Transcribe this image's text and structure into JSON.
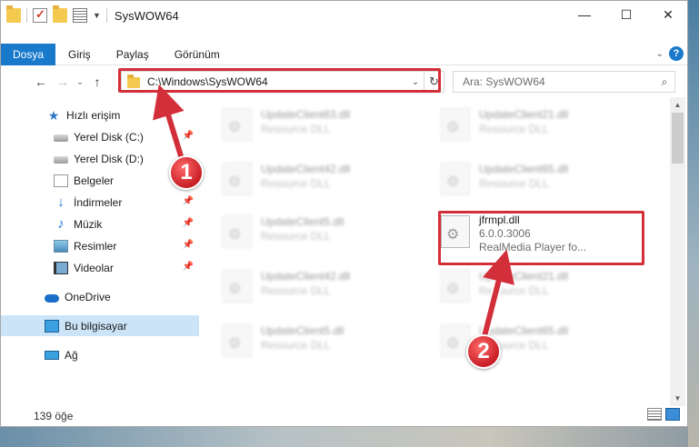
{
  "window": {
    "title": "SysWOW64",
    "controls": {
      "minimize": "—",
      "maximize": "☐",
      "close": "✕"
    }
  },
  "ribbon": {
    "tabs": [
      {
        "label": "Dosya"
      },
      {
        "label": "Giriş"
      },
      {
        "label": "Paylaş"
      },
      {
        "label": "Görünüm"
      }
    ],
    "help": "?"
  },
  "navigation": {
    "address": "C:\\Windows\\SysWOW64",
    "search_placeholder": "Ara: SysWOW64"
  },
  "sidebar": {
    "items": [
      {
        "label": "Hızlı erişim",
        "icon": "star-icon"
      },
      {
        "label": "Yerel Disk (C:)",
        "icon": "disk-icon"
      },
      {
        "label": "Yerel Disk (D:)",
        "icon": "disk-icon"
      },
      {
        "label": "Belgeler",
        "icon": "documents-icon"
      },
      {
        "label": "İndirmeler",
        "icon": "download-icon"
      },
      {
        "label": "Müzik",
        "icon": "music-icon"
      },
      {
        "label": "Resimler",
        "icon": "pictures-icon"
      },
      {
        "label": "Videolar",
        "icon": "videos-icon"
      },
      {
        "label": "OneDrive",
        "icon": "cloud-icon"
      },
      {
        "label": "Bu bilgisayar",
        "icon": "computer-icon"
      },
      {
        "label": "Ağ",
        "icon": "network-icon"
      }
    ]
  },
  "files": [
    {
      "name": "UpdateClient63.dll",
      "desc": "Resource DLL"
    },
    {
      "name": "UpdateClient21.dll",
      "desc": "Resource DLL"
    },
    {
      "name": "UpdateClient42.dll",
      "desc": "Resource DLL"
    },
    {
      "name": "UpdateClient65.dll",
      "desc": "Resource DLL"
    },
    {
      "name": "UpdateClient5.dll",
      "desc": "Resource DLL"
    },
    {
      "name": "jfrmpl.dll",
      "version": "6.0.0.3006",
      "desc": "RealMedia Player fo..."
    },
    {
      "name": "UpdateClient42.dll",
      "desc": "Resource DLL"
    },
    {
      "name": "UpdateClient21.dll",
      "desc": "Resource DLL"
    },
    {
      "name": "UpdateClient5.dll",
      "desc": "Resource DLL"
    },
    {
      "name": "UpdateClient65.dll",
      "desc": "Resource DLL"
    }
  ],
  "status": {
    "count": "139 öğe"
  },
  "annotations": {
    "step1": "1",
    "step2": "2",
    "color": "#d32f3a"
  }
}
